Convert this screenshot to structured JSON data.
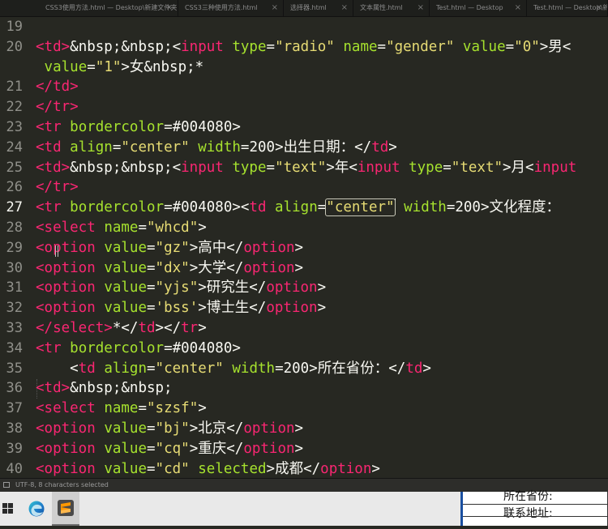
{
  "tabs": [
    {
      "label": "CSS3使用方法.html — Desktop\\新建文件夹",
      "active": false
    },
    {
      "label": "CSS3三种使用方法.html",
      "active": false
    },
    {
      "label": "选择器.html",
      "active": false
    },
    {
      "label": "文本属性.html",
      "active": false
    },
    {
      "label": "Test.html — Desktop",
      "active": false
    },
    {
      "label": "Test.html — Desktop\\新建文件",
      "active": false
    }
  ],
  "editor": {
    "active_line": "27",
    "lines": [
      {
        "num": "19",
        "tokens": []
      },
      {
        "num": "20",
        "tokens": [
          [
            "tg",
            "<td>"
          ],
          [
            "pl",
            "&nbsp;&nbsp;<"
          ],
          [
            "tg",
            "input"
          ],
          [
            "pl",
            " "
          ],
          [
            "at",
            "type"
          ],
          [
            "pl",
            "="
          ],
          [
            "st",
            "\"radio\""
          ],
          [
            "pl",
            " "
          ],
          [
            "at",
            "name"
          ],
          [
            "pl",
            "="
          ],
          [
            "st",
            "\"gender\""
          ],
          [
            "pl",
            " "
          ],
          [
            "at",
            "value"
          ],
          [
            "pl",
            "="
          ],
          [
            "st",
            "\"0\""
          ],
          [
            "pl",
            ">男<"
          ]
        ]
      },
      {
        "num": "",
        "tokens": [
          [
            "pl",
            " "
          ],
          [
            "at",
            "value"
          ],
          [
            "pl",
            "="
          ],
          [
            "st",
            "\"1\""
          ],
          [
            "pl",
            ">女&nbsp;*"
          ]
        ]
      },
      {
        "num": "21",
        "tokens": [
          [
            "tg",
            "</td>"
          ]
        ]
      },
      {
        "num": "22",
        "tokens": [
          [
            "tg",
            "</tr>"
          ]
        ]
      },
      {
        "num": "23",
        "tokens": [
          [
            "tg",
            "<tr"
          ],
          [
            "pl",
            " "
          ],
          [
            "at",
            "bordercolor"
          ],
          [
            "pl",
            "=#004080>"
          ]
        ]
      },
      {
        "num": "24",
        "tokens": [
          [
            "tg",
            "<td"
          ],
          [
            "pl",
            " "
          ],
          [
            "at",
            "align"
          ],
          [
            "pl",
            "="
          ],
          [
            "st",
            "\"center\""
          ],
          [
            "pl",
            " "
          ],
          [
            "at",
            "width"
          ],
          [
            "pl",
            "=200>出生日期：</"
          ],
          [
            "tg",
            "td"
          ],
          [
            "pl",
            ">"
          ]
        ]
      },
      {
        "num": "25",
        "tokens": [
          [
            "tg",
            "<td>"
          ],
          [
            "pl",
            "&nbsp;&nbsp;<"
          ],
          [
            "tg",
            "input"
          ],
          [
            "pl",
            " "
          ],
          [
            "at",
            "type"
          ],
          [
            "pl",
            "="
          ],
          [
            "st",
            "\"text\""
          ],
          [
            "pl",
            ">年<"
          ],
          [
            "tg",
            "input"
          ],
          [
            "pl",
            " "
          ],
          [
            "at",
            "type"
          ],
          [
            "pl",
            "="
          ],
          [
            "st",
            "\"text\""
          ],
          [
            "pl",
            ">月<"
          ],
          [
            "tg",
            "input"
          ]
        ]
      },
      {
        "num": "26",
        "tokens": [
          [
            "tg",
            "</tr>"
          ]
        ]
      },
      {
        "num": "27",
        "tokens": [
          [
            "tg",
            "<tr"
          ],
          [
            "pl",
            " "
          ],
          [
            "at",
            "bordercolor"
          ],
          [
            "pl",
            "=#004080><"
          ],
          [
            "tg",
            "td"
          ],
          [
            "pl",
            " "
          ],
          [
            "at",
            "align"
          ],
          [
            "pl",
            "="
          ],
          [
            "sel",
            "\"center\""
          ],
          [
            "caret",
            ""
          ],
          [
            "pl",
            " "
          ],
          [
            "at",
            "width"
          ],
          [
            "pl",
            "=200>文化程度："
          ]
        ]
      },
      {
        "num": "28",
        "tokens": [
          [
            "tg",
            "<select"
          ],
          [
            "pl",
            " "
          ],
          [
            "at",
            "name"
          ],
          [
            "pl",
            "="
          ],
          [
            "st",
            "\"whcd\""
          ],
          [
            "pl",
            ">"
          ]
        ]
      },
      {
        "num": "29",
        "tokens": [
          [
            "tg",
            "<option"
          ],
          [
            "pl",
            " "
          ],
          [
            "at",
            "value"
          ],
          [
            "pl",
            "="
          ],
          [
            "st",
            "\"gz\""
          ],
          [
            "pl",
            ">高中</"
          ],
          [
            "tg",
            "option"
          ],
          [
            "pl",
            ">"
          ]
        ]
      },
      {
        "num": "30",
        "tokens": [
          [
            "tg",
            "<option"
          ],
          [
            "pl",
            " "
          ],
          [
            "at",
            "value"
          ],
          [
            "pl",
            "="
          ],
          [
            "st",
            "\"dx\""
          ],
          [
            "pl",
            ">大学</"
          ],
          [
            "tg",
            "option"
          ],
          [
            "pl",
            ">"
          ]
        ]
      },
      {
        "num": "31",
        "tokens": [
          [
            "tg",
            "<option"
          ],
          [
            "pl",
            " "
          ],
          [
            "at",
            "value"
          ],
          [
            "pl",
            "="
          ],
          [
            "st",
            "\"yjs\""
          ],
          [
            "pl",
            ">研究生</"
          ],
          [
            "tg",
            "option"
          ],
          [
            "pl",
            ">"
          ]
        ]
      },
      {
        "num": "32",
        "tokens": [
          [
            "tg",
            "<option"
          ],
          [
            "pl",
            " "
          ],
          [
            "at",
            "value"
          ],
          [
            "pl",
            "="
          ],
          [
            "st",
            "'bss'"
          ],
          [
            "pl",
            ">博士生</"
          ],
          [
            "tg",
            "option"
          ],
          [
            "pl",
            ">"
          ]
        ]
      },
      {
        "num": "33",
        "tokens": [
          [
            "tg",
            "</select>"
          ],
          [
            "pl",
            "*</"
          ],
          [
            "tg",
            "td"
          ],
          [
            "pl",
            "></"
          ],
          [
            "tg",
            "tr"
          ],
          [
            "pl",
            ">"
          ]
        ]
      },
      {
        "num": "34",
        "tokens": [
          [
            "tg",
            "<tr"
          ],
          [
            "pl",
            " "
          ],
          [
            "at",
            "bordercolor"
          ],
          [
            "pl",
            "=#004080>"
          ]
        ]
      },
      {
        "num": "35",
        "tokens": [
          [
            "pl",
            "    <"
          ],
          [
            "tg",
            "td"
          ],
          [
            "pl",
            " "
          ],
          [
            "at",
            "align"
          ],
          [
            "pl",
            "="
          ],
          [
            "st",
            "\"center\""
          ],
          [
            "pl",
            " "
          ],
          [
            "at",
            "width"
          ],
          [
            "pl",
            "=200>所在省份：</"
          ],
          [
            "tg",
            "td"
          ],
          [
            "pl",
            ">"
          ]
        ]
      },
      {
        "num": "36",
        "tokens": [
          [
            "tg",
            "<td>"
          ],
          [
            "pl",
            "&nbsp;&nbsp;"
          ]
        ]
      },
      {
        "num": "37",
        "tokens": [
          [
            "tg",
            "<select"
          ],
          [
            "pl",
            " "
          ],
          [
            "at",
            "name"
          ],
          [
            "pl",
            "="
          ],
          [
            "st",
            "\"szsf\""
          ],
          [
            "pl",
            ">"
          ]
        ]
      },
      {
        "num": "38",
        "tokens": [
          [
            "tg",
            "<option"
          ],
          [
            "pl",
            " "
          ],
          [
            "at",
            "value"
          ],
          [
            "pl",
            "="
          ],
          [
            "st",
            "\"bj\""
          ],
          [
            "pl",
            ">北京</"
          ],
          [
            "tg",
            "option"
          ],
          [
            "pl",
            ">"
          ]
        ]
      },
      {
        "num": "39",
        "tokens": [
          [
            "tg",
            "<option"
          ],
          [
            "pl",
            " "
          ],
          [
            "at",
            "value"
          ],
          [
            "pl",
            "="
          ],
          [
            "st",
            "\"cq\""
          ],
          [
            "pl",
            ">重庆</"
          ],
          [
            "tg",
            "option"
          ],
          [
            "pl",
            ">"
          ]
        ]
      },
      {
        "num": "40",
        "tokens": [
          [
            "tg",
            "<option"
          ],
          [
            "pl",
            " "
          ],
          [
            "at",
            "value"
          ],
          [
            "pl",
            "="
          ],
          [
            "st",
            "\"cd\""
          ],
          [
            "pl",
            " "
          ],
          [
            "at",
            "selected"
          ],
          [
            "pl",
            ">成都</"
          ],
          [
            "tg",
            "option"
          ],
          [
            "pl",
            ">"
          ]
        ]
      }
    ]
  },
  "statusbar": {
    "text": "UTF-8, 8 characters selected",
    "icon": "panel-toggle-icon"
  },
  "taskbar": {
    "items": [
      {
        "name": "windows-start-icon"
      },
      {
        "name": "edge-browser-icon"
      },
      {
        "name": "sublime-text-icon",
        "active": true
      }
    ],
    "browser_preview": {
      "row1": "所在省份:",
      "row2": "联系地址:"
    }
  },
  "colors": {
    "background": "#272822",
    "tag": "#f92672",
    "attribute": "#a6e22e",
    "string": "#e6db74",
    "text": "#f8f8f2",
    "gutter": "#90908a",
    "taskbar_accent": "#1a4fa0"
  }
}
